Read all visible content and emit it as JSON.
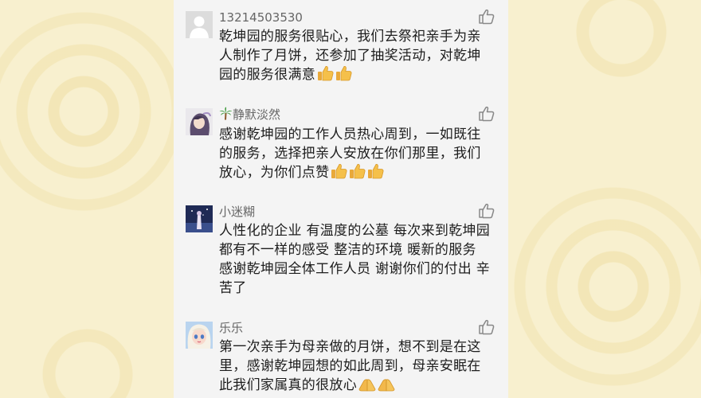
{
  "comments": [
    {
      "username": "13214503530",
      "avatar": "default-avatar",
      "lines": [
        "乾坤园的服务很贴心，我们去祭祀亲手为亲",
        "人制作了月饼，还参加了抽奖活动，对乾坤",
        "园的服务很满意"
      ],
      "emojis": [
        "thumbs-up",
        "thumbs-up"
      ]
    },
    {
      "username": "静默淡然",
      "username_prefix_icon": "palm-tree-icon",
      "avatar": "anime-girl-avatar",
      "lines": [
        "感谢乾坤园的工作人员热心周到，一如既往",
        "的服务，选择把亲人安放在你们那里，我们",
        "放心，为你们点赞"
      ],
      "emojis": [
        "thumbs-up",
        "thumbs-up",
        "thumbs-up"
      ]
    },
    {
      "username": "小迷糊",
      "avatar": "night-figure-avatar",
      "lines": [
        "人性化的企业 有温度的公墓 每次来到乾坤园",
        "都有不一样的感受  整洁的环境 暖新的服务",
        "感谢乾坤园全体工作人员 谢谢你们的付出 辛",
        "苦了"
      ],
      "emojis": []
    },
    {
      "username": "乐乐",
      "avatar": "doll-avatar",
      "lines": [
        "第一次亲手为母亲做的月饼，想不到是在这",
        "里，感谢乾坤园想的如此周到，母亲安眠在",
        "此我们家属真的很放心"
      ],
      "emojis": [
        "folded-hands",
        "folded-hands"
      ]
    }
  ],
  "colors": {
    "background": "#f8f0cf",
    "card": "#f4f4f4",
    "text": "#1d1d1d",
    "username": "#666666"
  }
}
